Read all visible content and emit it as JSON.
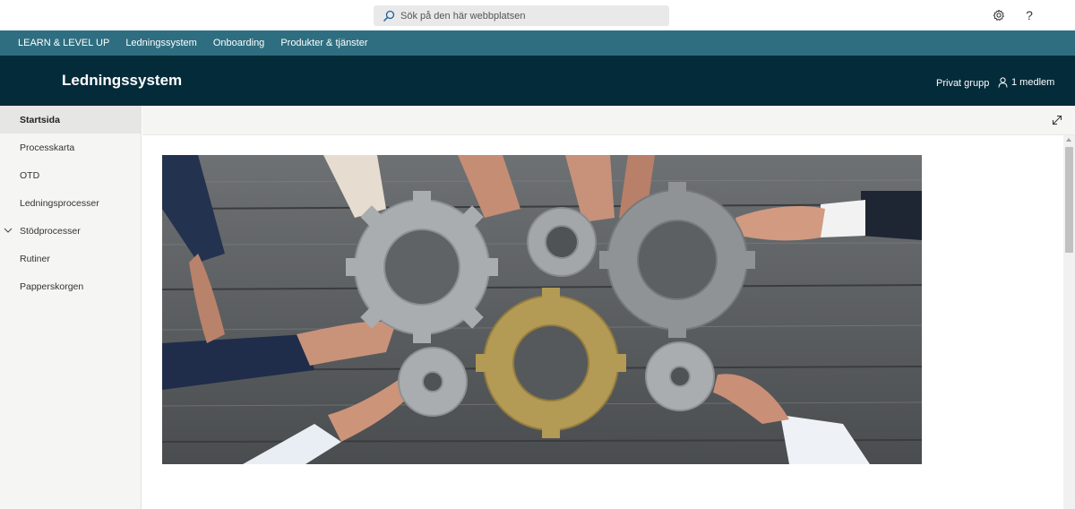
{
  "search": {
    "placeholder": "Sök på den här webbplatsen"
  },
  "suite": {
    "settings_icon": "gear-icon",
    "help_label": "?"
  },
  "hub_nav": {
    "items": [
      {
        "label": "LEARN & LEVEL UP"
      },
      {
        "label": "Ledningssystem"
      },
      {
        "label": "Onboarding"
      },
      {
        "label": "Produkter & tjänster"
      }
    ]
  },
  "site": {
    "title": "Ledningssystem",
    "privacy": "Privat grupp",
    "members": "1 medlem"
  },
  "left_nav": {
    "items": [
      {
        "label": "Startsida",
        "active": true
      },
      {
        "label": "Processkarta"
      },
      {
        "label": "OTD"
      },
      {
        "label": "Ledningsprocesser"
      },
      {
        "label": "Stödprocesser",
        "expandable": true
      },
      {
        "label": "Rutiner"
      },
      {
        "label": "Papperskorgen"
      }
    ]
  },
  "colors": {
    "hub_nav_bg": "#2e6e80",
    "site_header_bg": "#042b3a",
    "left_nav_bg": "#f5f5f4"
  },
  "hero": {
    "icon": "hero-image-gears-teamwork"
  }
}
